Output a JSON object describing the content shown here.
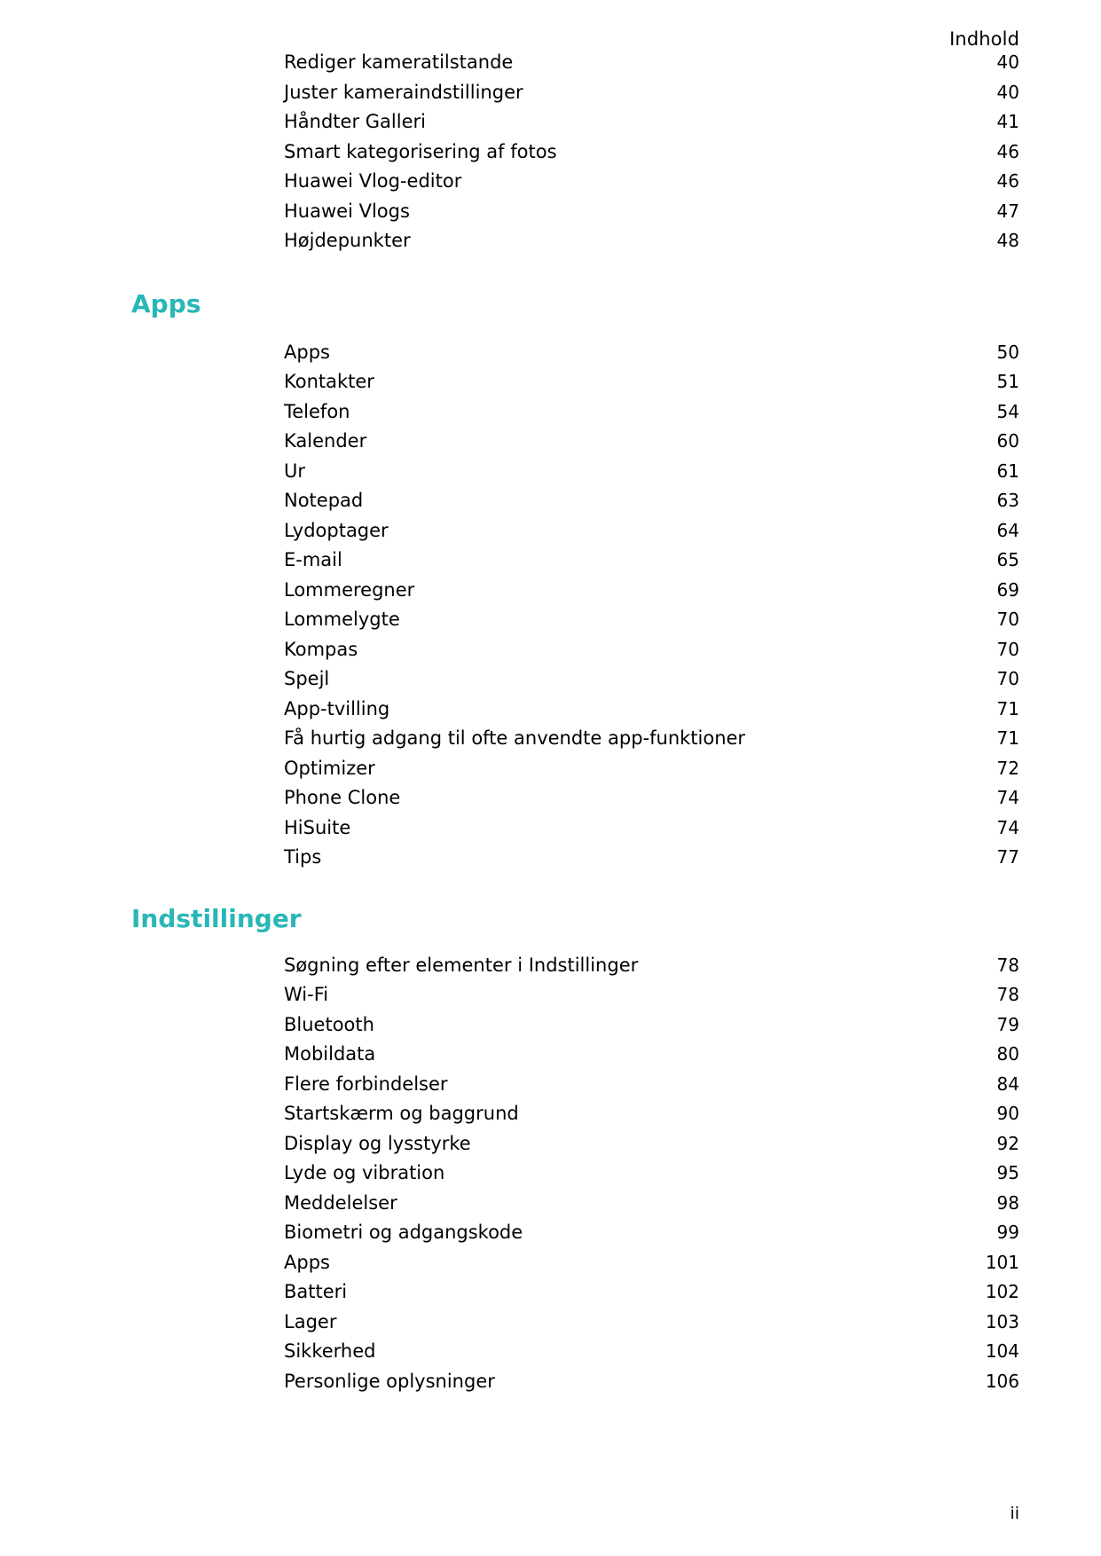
{
  "running_head": "Indhold",
  "folio": "ii",
  "accent_color": "#29b6b6",
  "groups": [
    {
      "heading": null,
      "entries": [
        {
          "title": "Rediger kameratilstande",
          "page": "40"
        },
        {
          "title": "Juster kameraindstillinger",
          "page": "40"
        },
        {
          "title": "Håndter Galleri",
          "page": "41"
        },
        {
          "title": "Smart kategorisering af fotos",
          "page": "46"
        },
        {
          "title": "Huawei Vlog-editor",
          "page": "46"
        },
        {
          "title": "Huawei Vlogs",
          "page": "47"
        },
        {
          "title": "Højdepunkter",
          "page": "48"
        }
      ]
    },
    {
      "heading": "Apps",
      "entries": [
        {
          "title": "Apps",
          "page": "50"
        },
        {
          "title": "Kontakter",
          "page": "51"
        },
        {
          "title": "Telefon",
          "page": "54"
        },
        {
          "title": "Kalender",
          "page": "60"
        },
        {
          "title": "Ur",
          "page": "61"
        },
        {
          "title": "Notepad",
          "page": "63"
        },
        {
          "title": "Lydoptager",
          "page": "64"
        },
        {
          "title": "E-mail",
          "page": "65"
        },
        {
          "title": "Lommeregner",
          "page": "69"
        },
        {
          "title": "Lommelygte",
          "page": "70"
        },
        {
          "title": "Kompas",
          "page": "70"
        },
        {
          "title": "Spejl",
          "page": "70"
        },
        {
          "title": "App-tvilling",
          "page": "71"
        },
        {
          "title": "Få hurtig adgang til ofte anvendte app-funktioner",
          "page": "71"
        },
        {
          "title": "Optimizer",
          "page": "72"
        },
        {
          "title": "Phone Clone",
          "page": "74"
        },
        {
          "title": "HiSuite",
          "page": "74"
        },
        {
          "title": "Tips",
          "page": "77"
        }
      ]
    },
    {
      "heading": "Indstillinger",
      "entries": [
        {
          "title": "Søgning efter elementer i Indstillinger",
          "page": "78"
        },
        {
          "title": "Wi-Fi",
          "page": "78"
        },
        {
          "title": "Bluetooth",
          "page": "79"
        },
        {
          "title": "Mobildata",
          "page": "80"
        },
        {
          "title": "Flere forbindelser",
          "page": "84"
        },
        {
          "title": "Startskærm og baggrund",
          "page": "90"
        },
        {
          "title": "Display og lysstyrke",
          "page": "92"
        },
        {
          "title": "Lyde og vibration",
          "page": "95"
        },
        {
          "title": "Meddelelser",
          "page": "98"
        },
        {
          "title": "Biometri og adgangskode",
          "page": "99"
        },
        {
          "title": "Apps",
          "page": "101"
        },
        {
          "title": "Batteri",
          "page": "102"
        },
        {
          "title": "Lager",
          "page": "103"
        },
        {
          "title": "Sikkerhed",
          "page": "104"
        },
        {
          "title": "Personlige oplysninger",
          "page": "106"
        }
      ]
    }
  ]
}
